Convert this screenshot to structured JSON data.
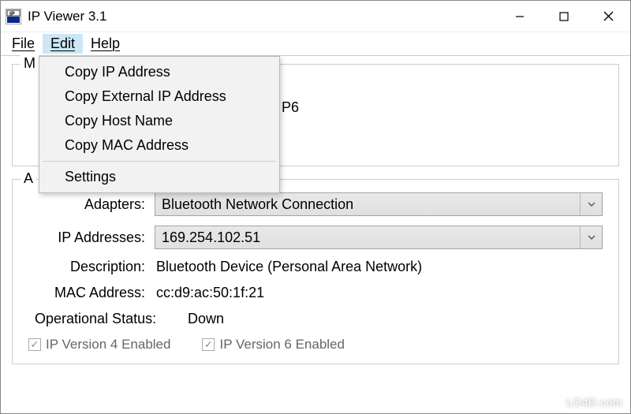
{
  "window": {
    "title": "IP Viewer 3.1"
  },
  "menubar": {
    "file": "File",
    "edit": "Edit",
    "help": "Help"
  },
  "edit_menu": {
    "copy_ip": "Copy IP Address",
    "copy_ext_ip": "Copy External IP Address",
    "copy_host": "Copy Host Name",
    "copy_mac": "Copy MAC Address",
    "settings": "Settings"
  },
  "group1": {
    "legend_visible": "M",
    "peek_text": "P6"
  },
  "group2_legend": "A",
  "fields": {
    "adapters_label": "Adapters:",
    "adapters_value": "Bluetooth Network Connection",
    "ip_label": "IP Addresses:",
    "ip_value": "169.254.102.51",
    "desc_label": "Description:",
    "desc_value": "Bluetooth Device (Personal Area Network)",
    "mac_label": "MAC Address:",
    "mac_value": "cc:d9:ac:50:1f:21",
    "op_label": "Operational Status:",
    "op_value": "Down",
    "ipv4_label": "IP Version 4 Enabled",
    "ipv6_label": "IP Version 6 Enabled"
  },
  "watermark": "LO4D.com"
}
